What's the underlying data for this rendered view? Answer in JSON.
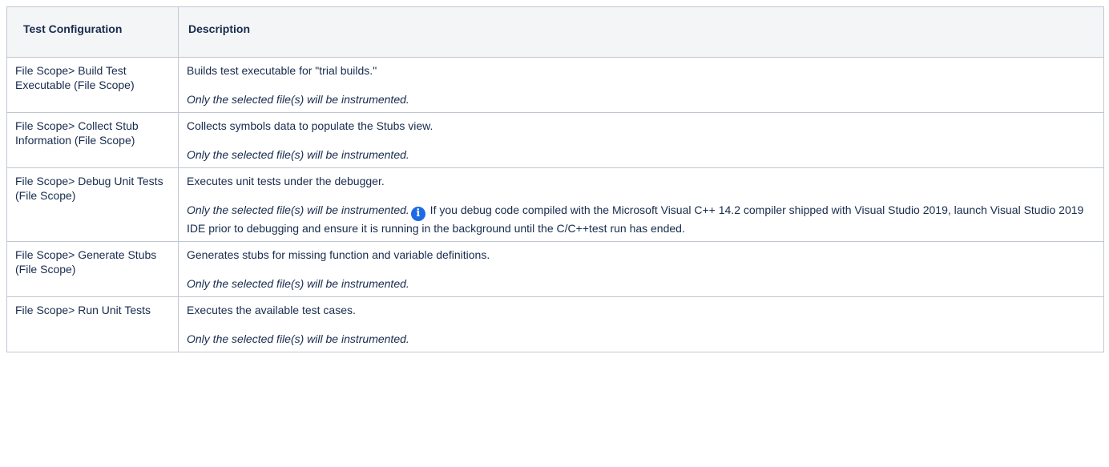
{
  "table": {
    "headers": {
      "config": "Test Configuration",
      "description": "Description"
    },
    "rows": [
      {
        "name": "File Scope> Build Test Executable (File Scope)",
        "summary": "Builds test executable for \"trial builds.\"",
        "note": "Only the selected file(s) will be instrumented.",
        "extra": ""
      },
      {
        "name": "File Scope> Collect Stub Information (File Scope)",
        "summary": "Collects symbols data to populate the Stubs view.",
        "note": "Only the selected file(s) will be instrumented.",
        "extra": ""
      },
      {
        "name": "File Scope> Debug Unit Tests (File Scope)",
        "summary": "Executes unit tests under the debugger.",
        "note": "Only the selected file(s) will be instrumented.",
        "extra": " If you debug code compiled with the Microsoft Visual C++ 14.2 compiler shipped with Visual Studio 2019, launch Visual Studio 2019 IDE prior to debugging and ensure it is running in the background until the C/C++test run has ended."
      },
      {
        "name": "File Scope> Generate Stubs (File Scope)",
        "summary": "Generates stubs for missing function and variable definitions.",
        "note": "Only the selected file(s) will be instrumented.",
        "extra": ""
      },
      {
        "name": "File Scope> Run Unit Tests",
        "summary": "Executes the available test cases.",
        "note": "Only the selected file(s) will be instrumented.",
        "extra": ""
      }
    ]
  },
  "icons": {
    "info": "info-icon",
    "info_glyph": "i",
    "info_color": "#1d6ae5"
  },
  "colors": {
    "header_bg": "#f4f5f7",
    "border": "#c1c7d0",
    "text": "#172b4d"
  }
}
